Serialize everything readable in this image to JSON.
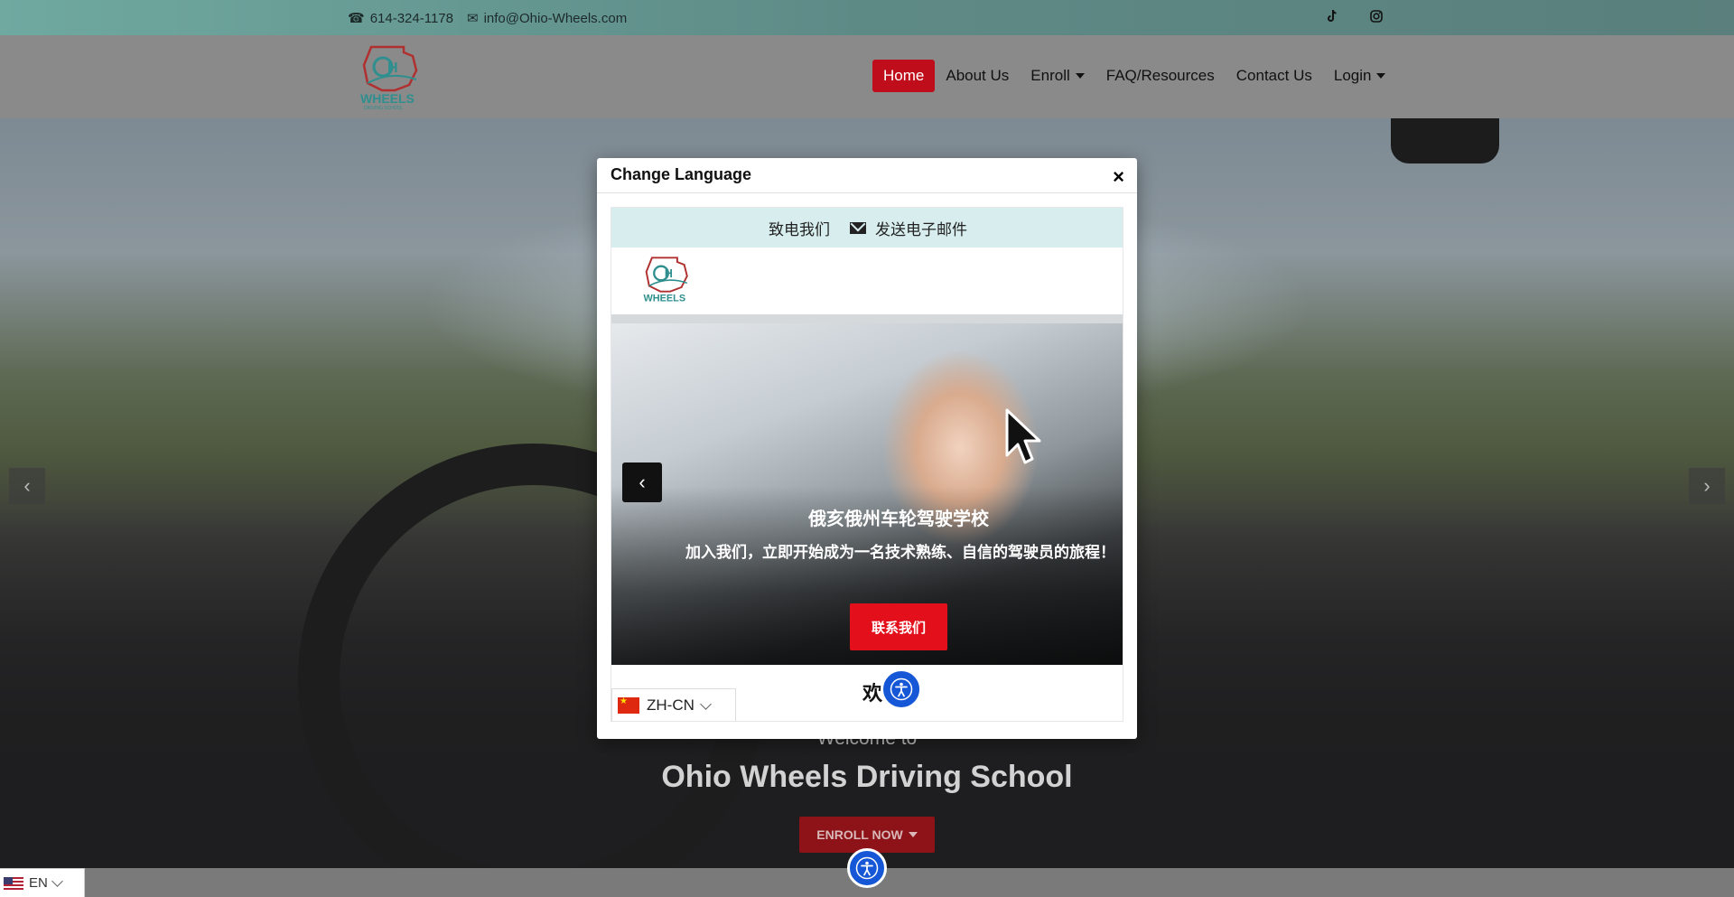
{
  "topbar": {
    "phone": "614-324-1178",
    "email": "info@Ohio-Wheels.com",
    "social": [
      {
        "icon": "tiktok-icon"
      },
      {
        "icon": "instagram-icon"
      }
    ]
  },
  "header": {
    "logo_alt": "OH WHEELS DRIVING SCHOOL",
    "nav": [
      {
        "label": "Home",
        "active": true
      },
      {
        "label": "About Us"
      },
      {
        "label": "Enroll",
        "dropdown": true
      },
      {
        "label": "FAQ/Resources"
      },
      {
        "label": "Contact Us"
      },
      {
        "label": "Login",
        "dropdown": true
      }
    ]
  },
  "hero": {
    "welcome": "Welcome to",
    "title": "Ohio Wheels Driving School",
    "enroll_label": "ENROLL NOW"
  },
  "language_switch": {
    "current": "EN"
  },
  "modal": {
    "title": "Change Language",
    "close": "×",
    "preview": {
      "top_call": "致电我们",
      "top_email": "发送电子邮件",
      "hero_title": "俄亥俄州车轮驾驶学校",
      "hero_sub": "加入我们，立即开始成为一名技术熟练、自信的驾驶员的旅程！",
      "button": "联系我们",
      "bottom_text": "欢",
      "lang": "ZH-CN"
    }
  },
  "colors": {
    "accent_red": "#c00d1c",
    "topbar": "#6fa9a0",
    "access_blue": "#1557d6"
  }
}
